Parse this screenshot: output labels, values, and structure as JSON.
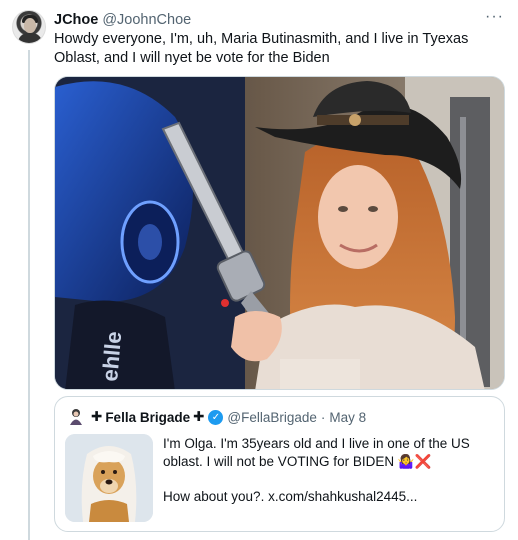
{
  "tweet": {
    "author_name": "JChoe",
    "author_handle": "@JoohnChoe",
    "more_icon": "···",
    "text": "Howdy everyone, I'm, uh, Maria Butinasmith, and I live in Tyexas Oblast, and I will nyet be vote for the Biden"
  },
  "quote": {
    "name_prefix": "✚",
    "name": "Fella Brigade",
    "name_suffix": "✚",
    "verified_icon": "✓",
    "handle": "@FellaBrigade",
    "separator": "·",
    "date": "May 8",
    "line1": "I'm Olga. I'm 35years old and I live in one of the US oblast. I will not be VOTING for BIDEN 🤷‍♀️❌",
    "line2": "How about you?.  x.com/shahkushal2445..."
  },
  "colors": {
    "verified": "#1d9bf0",
    "secondary_text": "#536471",
    "border": "#cfd9de"
  }
}
